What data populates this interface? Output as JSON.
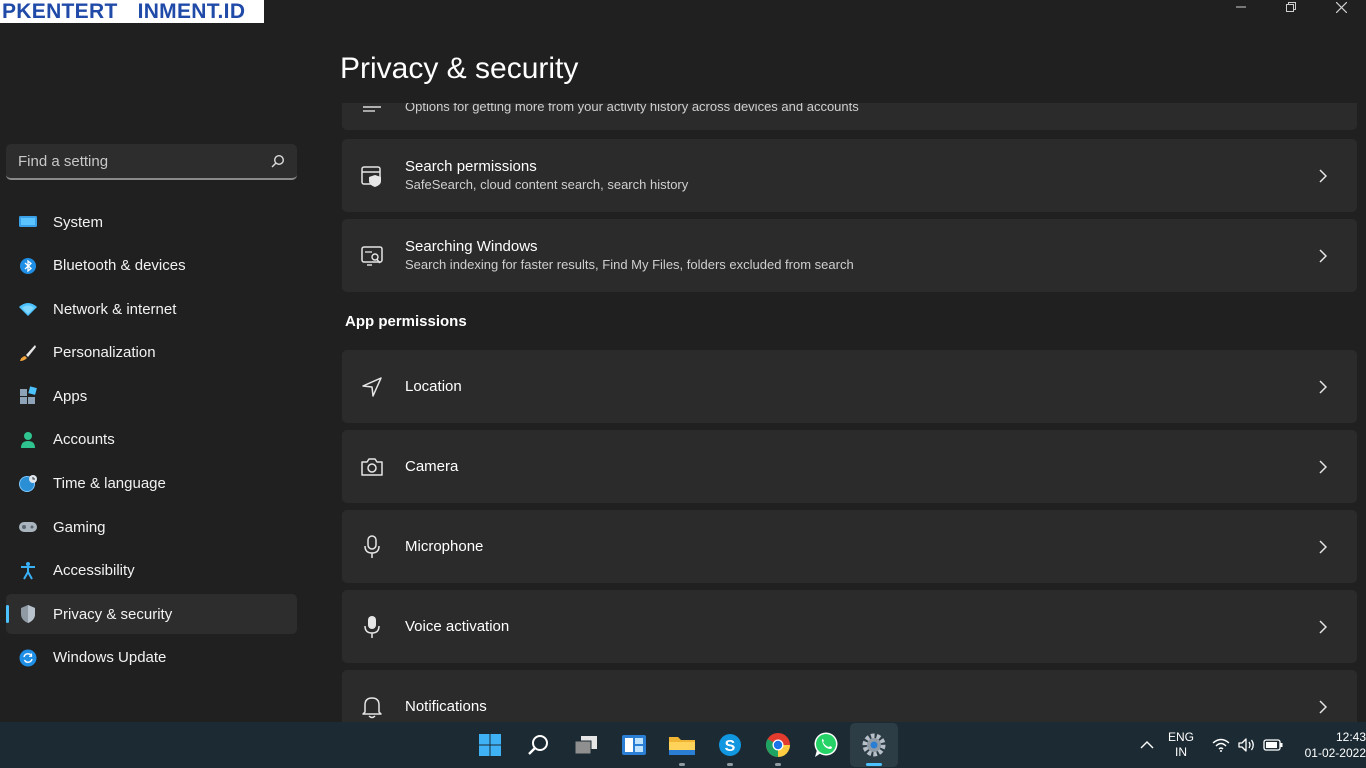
{
  "watermark": "PKENTERTAINMENT.ID",
  "window": {
    "title": "Privacy & security"
  },
  "sidebar": {
    "search_placeholder": "Find a setting",
    "items": [
      {
        "label": "System",
        "icon": "monitor-icon"
      },
      {
        "label": "Bluetooth & devices",
        "icon": "bluetooth-icon"
      },
      {
        "label": "Network & internet",
        "icon": "wifi-icon"
      },
      {
        "label": "Personalization",
        "icon": "brush-icon"
      },
      {
        "label": "Apps",
        "icon": "apps-icon"
      },
      {
        "label": "Accounts",
        "icon": "person-icon"
      },
      {
        "label": "Time & language",
        "icon": "globe-clock-icon"
      },
      {
        "label": "Gaming",
        "icon": "gamepad-icon"
      },
      {
        "label": "Accessibility",
        "icon": "accessibility-icon"
      },
      {
        "label": "Privacy & security",
        "icon": "shield-icon",
        "active": true
      },
      {
        "label": "Windows Update",
        "icon": "update-icon"
      }
    ]
  },
  "main": {
    "partial_card": {
      "subtitle": "Options for getting more from your activity history across devices and accounts"
    },
    "cards": [
      {
        "title": "Search permissions",
        "subtitle": "SafeSearch, cloud content search, search history",
        "icon": "search-permissions-icon"
      },
      {
        "title": "Searching Windows",
        "subtitle": "Search indexing for faster results, Find My Files, folders excluded from search",
        "icon": "searching-windows-icon"
      }
    ],
    "section_heading": "App permissions",
    "app_permissions": [
      {
        "title": "Location",
        "icon": "location-icon"
      },
      {
        "title": "Camera",
        "icon": "camera-icon"
      },
      {
        "title": "Microphone",
        "icon": "microphone-icon"
      },
      {
        "title": "Voice activation",
        "icon": "voice-activation-icon"
      },
      {
        "title": "Notifications",
        "icon": "bell-icon"
      }
    ]
  },
  "taskbar": {
    "apps": [
      "start-icon",
      "search-icon",
      "task-view-icon",
      "widgets-icon",
      "file-explorer-icon",
      "skype-icon",
      "chrome-icon",
      "whatsapp-icon",
      "settings-icon"
    ],
    "tray": {
      "lang_line1": "ENG",
      "lang_line2": "IN",
      "time": "12:43",
      "date": "01-02-2022"
    }
  },
  "colors": {
    "accent": "#4cc2ff",
    "background": "#202020",
    "card": "#2b2b2b",
    "taskbar": "#1c2b33"
  }
}
